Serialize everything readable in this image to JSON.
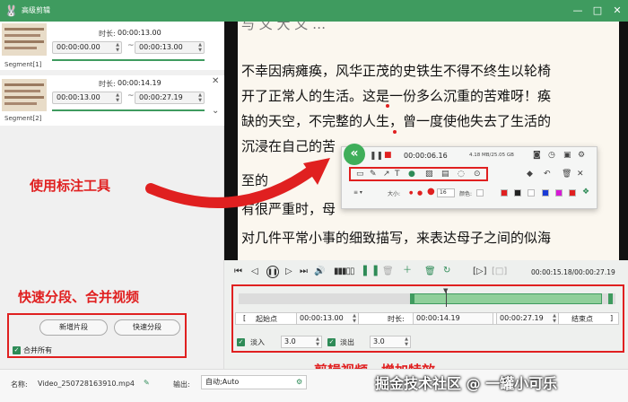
{
  "window": {
    "title": "高级剪辑",
    "minimize": "—",
    "maximize": "□",
    "close": "✕"
  },
  "segments": [
    {
      "label": "Segment[1]",
      "duration_label": "时长:",
      "duration": "00:00:13.00",
      "start": "00:00:00.00",
      "end": "00:00:13.00"
    },
    {
      "label": "Segment[2]",
      "duration_label": "时长:",
      "duration": "00:00:14.19",
      "start": "00:00:13.00",
      "end": "00:00:27.19"
    }
  ],
  "segment_tilde": "~",
  "left_buttons": {
    "new_segment": "新增片段",
    "quick_split": "快速分段",
    "merge_all": "合并所有"
  },
  "annotations": {
    "use_tools": "使用标注工具",
    "quick_split_merge": "快速分段、合并视频",
    "clip_effects": "剪辑视频、增加特效"
  },
  "video_text": [
    "不幸因病瘫痪，风华正茂的史铁生不得不终生以轮椅",
    "开了正常人的生活。这是一份多么沉重的苦难呀！痪",
    "缺的天空，不完整的人生，曾一度使他失去了生活的",
    "沉浸在自己的苦",
    "至的",
    "有很严重时，母",
    "对几件平常小事的细致描写，来表达母子之间的似海"
  ],
  "toolbar": {
    "time": "00:00:06.16",
    "size": "4.18 MB/25.05 GB",
    "size_label": "大小:",
    "size_value": "16",
    "opacity_label": "颜色:"
  },
  "controls": {
    "time_readout": "00:00:15.18/00:00:27.19"
  },
  "editor": {
    "start_button": "起始点",
    "start_time": "00:00:13.00",
    "duration_label": "时长:",
    "duration": "00:00:14.19",
    "end_time": "00:00:27.19",
    "end_button": "结束点",
    "fade_in_label": "淡入",
    "fade_in": "3.0",
    "fade_out_label": "淡出",
    "fade_out": "3.0"
  },
  "watermark": "掘金技术社区 @ 一罐小可乐",
  "bottom": {
    "name_label": "名称:",
    "name_value": "Video_250728163910.mp4",
    "output_label": "输出:",
    "output_value": "自动;Auto"
  },
  "colors": {
    "accent": "#3f9b5f",
    "annotation": "#e02020"
  }
}
